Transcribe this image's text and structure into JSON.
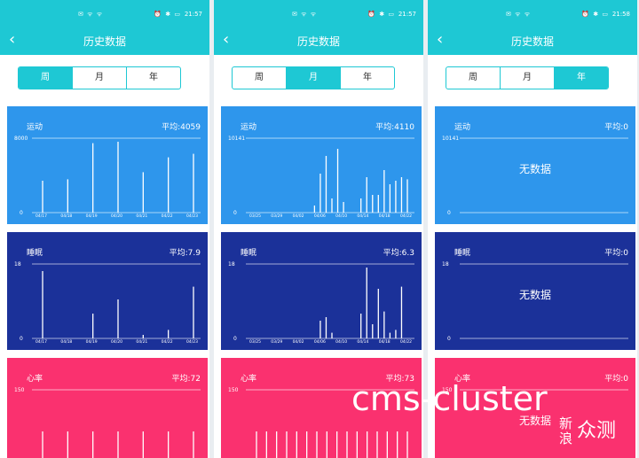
{
  "phones": [
    {
      "status": {
        "left_icons": "✉ ᯤ ᯤ",
        "right_icons": "⏰ ✱ ▭",
        "time": "21:57"
      },
      "title": "历史数据",
      "tabs": [
        {
          "label": "周",
          "active": true
        },
        {
          "label": "月",
          "active": false
        },
        {
          "label": "年",
          "active": false
        }
      ],
      "cards": [
        {
          "label": "运动",
          "avg": "平均:4059",
          "ymax": "8000",
          "ymin": "0",
          "xticks": [
            "04/17",
            "04/18",
            "04/19",
            "04/20",
            "04/21",
            "04/22",
            "04/23"
          ],
          "values": [
            0.45,
            0.47,
            0.98,
            1.0,
            0.57,
            0.78,
            0.83
          ],
          "nodata": ""
        },
        {
          "label": "睡眠",
          "avg": "平均:7.9",
          "ymax": "18",
          "ymin": "0",
          "xticks": [
            "04/17",
            "04/18",
            "04/19",
            "04/20",
            "04/21",
            "04/22",
            "04/23"
          ],
          "values": [
            0.95,
            0,
            0.35,
            0.55,
            0.05,
            0.12,
            0.73
          ],
          "nodata": ""
        },
        {
          "label": "心率",
          "avg": "平均:72",
          "ymax": "150",
          "ymin": "",
          "xticks": [],
          "values": [
            0.5,
            0.5,
            0.5,
            0.5,
            0.5,
            0.5,
            0.5
          ],
          "nodata": ""
        }
      ]
    },
    {
      "status": {
        "left_icons": "✉ ᯤ ᯤ",
        "right_icons": "⏰ ✱ ▭",
        "time": "21:57"
      },
      "title": "历史数据",
      "tabs": [
        {
          "label": "周",
          "active": false
        },
        {
          "label": "月",
          "active": true
        },
        {
          "label": "年",
          "active": false
        }
      ],
      "cards": [
        {
          "label": "运动",
          "avg": "平均:4110",
          "ymax": "10141",
          "ymin": "0",
          "xticks": [
            "03/25",
            "03/29",
            "04/02",
            "04/06",
            "04/10",
            "04/14",
            "04/18",
            "04/22"
          ],
          "values": [
            0,
            0,
            0,
            0,
            0,
            0,
            0,
            0,
            0,
            0,
            0.1,
            0.55,
            0.8,
            0.2,
            0.9,
            0.15,
            0,
            0,
            0.2,
            0.5,
            0.25,
            0.25,
            0.6,
            0.4,
            0.45,
            0.5,
            0.47
          ],
          "nodata": ""
        },
        {
          "label": "睡眠",
          "avg": "平均:6.3",
          "ymax": "18",
          "ymin": "0",
          "xticks": [
            "03/25",
            "03/29",
            "04/02",
            "04/06",
            "04/10",
            "04/14",
            "04/18",
            "04/22"
          ],
          "values": [
            0,
            0,
            0,
            0,
            0,
            0,
            0,
            0,
            0,
            0,
            0,
            0.25,
            0.3,
            0.08,
            0,
            0,
            0,
            0,
            0.35,
            1.0,
            0.2,
            0.7,
            0.38,
            0.08,
            0.12,
            0.73,
            0
          ],
          "nodata": ""
        },
        {
          "label": "心率",
          "avg": "平均:73",
          "ymax": "150",
          "ymin": "",
          "xticks": [],
          "values": [
            0.55,
            0.5,
            0.5,
            0.5,
            0.5,
            0.5,
            0.55,
            0.5,
            0.5,
            0.5,
            0.5,
            0.5,
            0.5,
            0.5,
            0.5,
            0.5
          ],
          "nodata": ""
        }
      ]
    },
    {
      "status": {
        "left_icons": "✉ ᯤ ᯤ",
        "right_icons": "⏰ ✱ ▭",
        "time": "21:58"
      },
      "title": "历史数据",
      "tabs": [
        {
          "label": "周",
          "active": false
        },
        {
          "label": "月",
          "active": false
        },
        {
          "label": "年",
          "active": true
        }
      ],
      "cards": [
        {
          "label": "运动",
          "avg": "平均:0",
          "ymax": "10141",
          "ymin": "0",
          "xticks": [],
          "values": [],
          "nodata": "无数据"
        },
        {
          "label": "睡眠",
          "avg": "平均:0",
          "ymax": "18",
          "ymin": "0",
          "xticks": [],
          "values": [],
          "nodata": "无数据"
        },
        {
          "label": "心率",
          "avg": "平均:0",
          "ymax": "150",
          "ymin": "",
          "xticks": [],
          "values": [],
          "nodata": "无数据"
        }
      ]
    }
  ],
  "watermark": {
    "text": "cms-cluster",
    "brand_small": "新浪",
    "brand_big": "众测"
  }
}
